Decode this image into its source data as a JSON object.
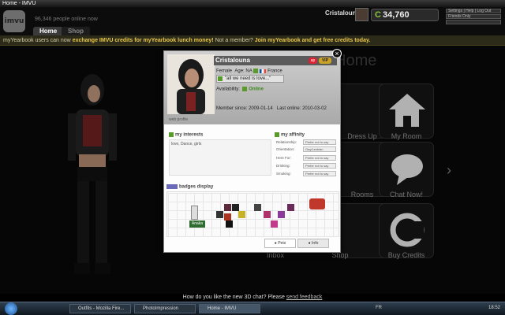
{
  "window": {
    "title": "Home - IMVU"
  },
  "header": {
    "logo": "imvu",
    "online_count": "96,346 people online now",
    "nav": {
      "home": "Home",
      "shop": "Shop"
    },
    "username": "Cristalouna",
    "credits": "34,760",
    "buttons": [
      "Settings",
      "Help",
      "Log Out",
      "Friends Only"
    ]
  },
  "promo": {
    "text1": "myYearbook users can now ",
    "link1": "exchange IMVU credits for myYearbook lunch money!",
    "text2": " Not a member? ",
    "link2": "Join myYearbook and get free credits today."
  },
  "main": {
    "page_heading": "Home",
    "tiles": [
      {
        "label": "Dress Up"
      },
      {
        "label": "My Room"
      },
      {
        "label": "Rooms"
      },
      {
        "label": "Chat Now!"
      },
      {
        "label": "Inbox"
      },
      {
        "label": "Shop"
      },
      {
        "label": "Buy Credits"
      }
    ]
  },
  "profile": {
    "name": "Cristalouna",
    "badge_ap": "ap",
    "badge_vip": "VIP",
    "gender": "Female",
    "age": "Age: NA",
    "country": "France",
    "tagline": "\"all we need is love...\"",
    "availability_label": "Availability:",
    "availability_value": "Online",
    "member_since": "Member since: 2009-01-14",
    "last_online": "Last online: 2010-03-02",
    "web_profile": "web profile",
    "interests_title": "my interests",
    "interests": "love, Dance, girls",
    "affinity_title": "my affinity",
    "affinity": [
      {
        "label": "Relationship:",
        "value": "Prefer not to say"
      },
      {
        "label": "Orientation:",
        "value": "Gay/Lesbian"
      },
      {
        "label": "Here For:",
        "value": "Prefer not to say"
      },
      {
        "label": "Drinking:",
        "value": "Prefer not to say"
      },
      {
        "label": "Smoking:",
        "value": "Prefer not to say"
      }
    ],
    "badges_title": "badges display",
    "badge_name": "Anaka",
    "tabs": {
      "pets": "Pets",
      "info": "Info"
    }
  },
  "feedback": {
    "text": "How do you like the new 3D chat? Please ",
    "link": "send feedback"
  },
  "taskbar": {
    "items": [
      "Outfits - Mozilla Fire...",
      "PhotoImpression",
      "Home - IMVU"
    ],
    "lang": "FR",
    "time": "18:52"
  },
  "colors": {
    "accent_green": "#8cc63f",
    "promo_link": "#e9c84b",
    "vip_gold": "#c9a227"
  }
}
